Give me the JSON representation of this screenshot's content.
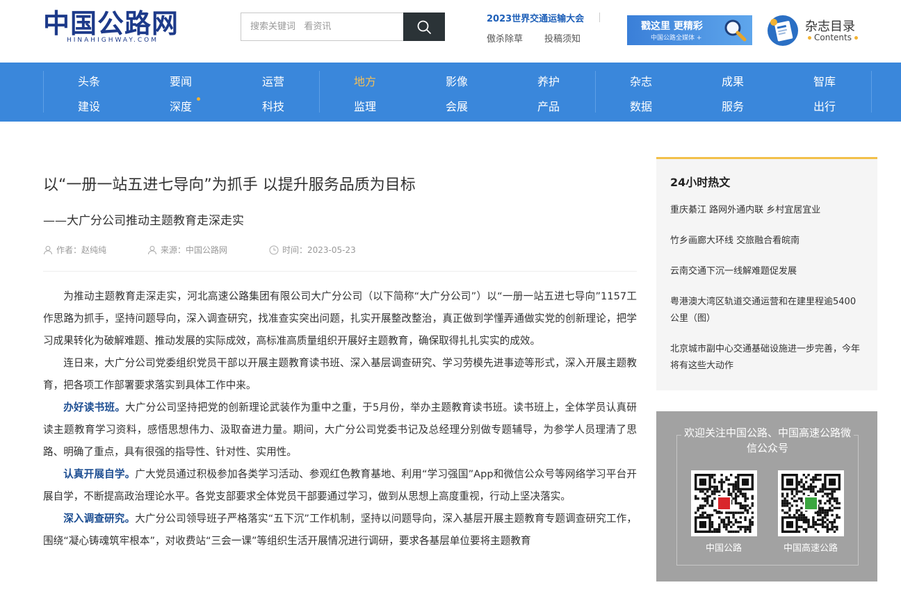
{
  "header": {
    "logo_cn": "中国公路网",
    "logo_en": "HINAHIGHWAY.COM",
    "search_placeholder": "搜索关键词   看资讯",
    "top_links": {
      "conference": "2023世界交通运输大会",
      "link_a": "傲杀除草",
      "link_b": "投稿须知"
    },
    "banner": {
      "line1": "戳这里  更精彩",
      "line2": "中国公路全媒体 +"
    },
    "magazine": {
      "title": "杂志目录",
      "subtitle": "Contents"
    }
  },
  "nav": {
    "row1": [
      "头条",
      "要闻",
      "运营",
      "地方",
      "影像",
      "养护",
      "杂志",
      "成果",
      "智库"
    ],
    "row2": [
      "建设",
      "深度",
      "科技",
      "监理",
      "会展",
      "产品",
      "数据",
      "服务",
      "出行"
    ],
    "active_item": "地方",
    "colors": {
      "bar": "#3a87db",
      "active": "#f6c057"
    }
  },
  "article": {
    "title": "以“一册一站五进七导向”为抓手 以提升服务品质为目标",
    "subtitle": "——大广分公司推动主题教育走深走实",
    "author": "作者：赵纯纯",
    "source": "来源：中国公路网",
    "time": "时间：2023-05-23",
    "paragraphs": [
      {
        "lead": "",
        "text": "为推动主题教育走深走实，河北高速公路集团有限公司大广分公司（以下简称“大广分公司”）以“一册一站五进七导向”1157工作思路为抓手，坚持问题导向，深入调查研究，找准查实突出问题，扎实开展整改整治，真正做到学懂弄通做实党的创新理论，把学习成果转化为破解难题、推动发展的实际成效，高标准高质量组织开展好主题教育，确保取得扎扎实实的成效。"
      },
      {
        "lead": "",
        "text": "连日来，大广分公司党委组织党员干部以开展主题教育读书班、深入基层调查研究、学习劳模先进事迹等形式，深入开展主题教育，把各项工作部署要求落实到具体工作中来。"
      },
      {
        "lead": "办好读书班。",
        "text": "大广分公司坚持把党的创新理论武装作为重中之重，于5月份，举办主题教育读书班。读书班上，全体学员认真研读主题教育学习资料，感悟思想伟力、汲取奋进力量。期间，大广分公司党委书记及总经理分别做专题辅导，为参学人员理清了思路、明确了重点，具有很强的指导性、针对性、实用性。"
      },
      {
        "lead": "认真开展自学。",
        "text": "广大党员通过积极参加各类学习活动、参观红色教育基地、利用“学习强国”App和微信公众号等网络学习平台开展自学，不断提高政治理论水平。各党支部要求全体党员干部要通过学习，做到从思想上高度重视，行动上坚决落实。"
      },
      {
        "lead": "深入调查研究。",
        "text": "大广分公司领导班子严格落实“五下沉”工作机制，坚持以问题导向，深入基层开展主题教育专题调查研究工作，围绕“凝心铸魂筑牢根本”，对收费站“三会一课”等组织生活开展情况进行调研，要求各基层单位要将主题教育"
      }
    ]
  },
  "sidebar": {
    "hot_title": "24小时热文",
    "hot_items": [
      "重庆綦江 路网外通内联 乡村宜居宜业",
      "竹乡画廊大环线 交旅融合看皖南",
      "云南交通下沉一线解难题促发展",
      "粤港澳大湾区轨道交通运营和在建里程逾5400公里（图）",
      "北京城市副中心交通基础设施进一步完善，今年将有这些大动作"
    ],
    "follow_title": "欢迎关注中国公路、中国高速公路微信公众号",
    "qr_left_label": "中国公路",
    "qr_right_label": "中国高速公路"
  }
}
